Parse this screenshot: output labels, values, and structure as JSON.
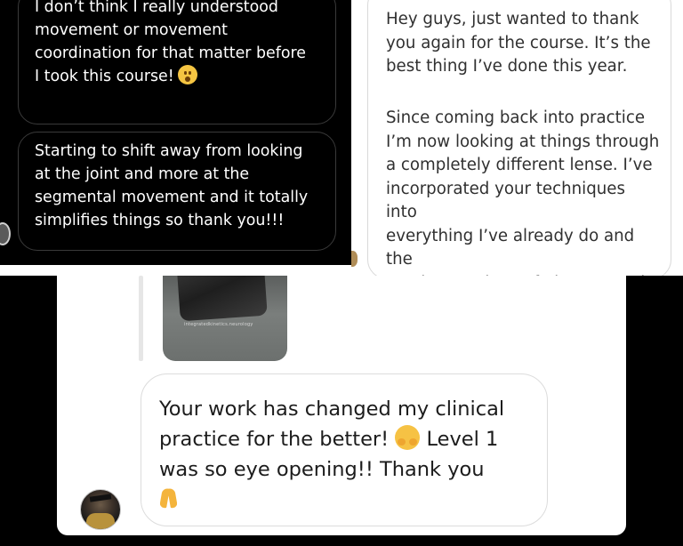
{
  "dark_thread": {
    "message_1": "I don’t think I really understood\nmovement or movement\ncoordination for that matter before\nI took this course!",
    "message_1_emoji": "surprised-face",
    "message_2": "Starting to shift away from looking\nat the joint and more at the\nsegmental movement and it totally\nsimplifies things so thank you!!!"
  },
  "light_thread": {
    "paragraph_1": "Hey guys, just wanted to thank\nyou again for the course. It’s the\nbest thing I’ve done this year.",
    "paragraph_2": "Since coming back into practice\nI’m now looking at things through\na completely different lense. I’ve\nincorporated your techniques into\neverything I’ve already do and the\nresults are short of phenomenal.\nThank you so much"
  },
  "bottom_thread": {
    "story_caption": "integratedkinetics.neurology",
    "message_part_1": "Your work has changed my clinical\npractice for the better! ",
    "message_emoji_1": "hugging-face",
    "message_part_2": " Level 1\nwas so eye opening!! Thank you\n",
    "message_emoji_2": "folded-hands"
  },
  "colors": {
    "dark_background": "#000000",
    "dark_bubble_border": "#3a3a3a",
    "light_bubble_border": "#d9d9d9",
    "light_text": "#303030",
    "bottom_text": "#1c1c1c"
  }
}
